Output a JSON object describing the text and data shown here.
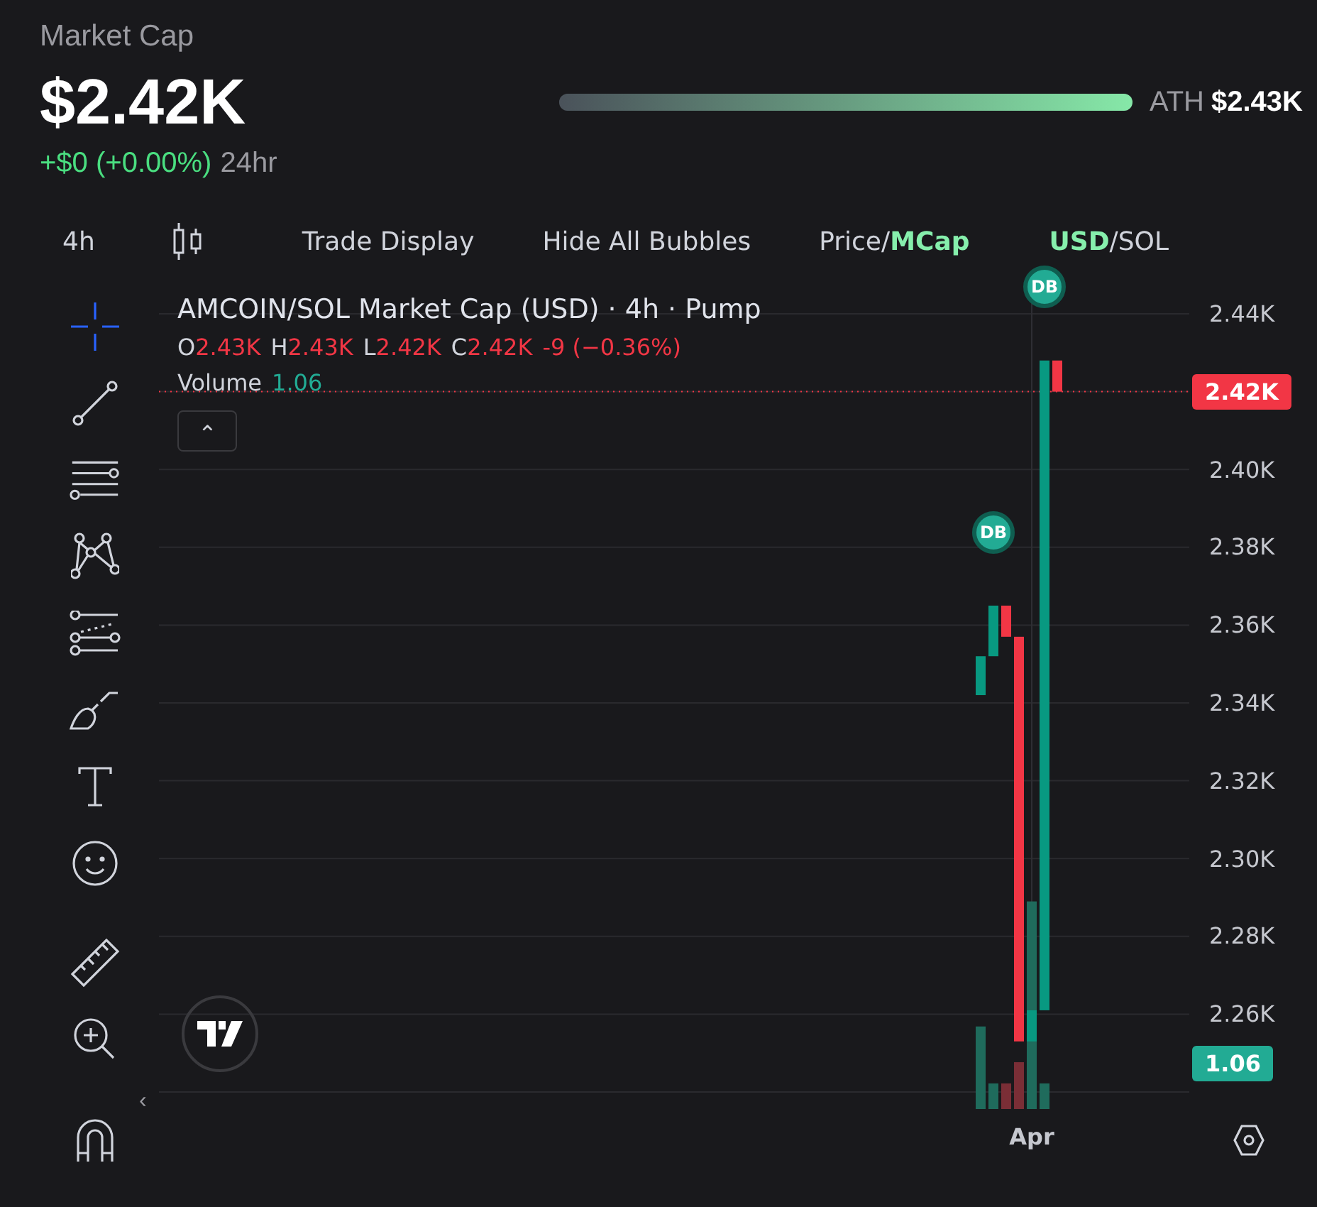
{
  "header": {
    "label": "Market Cap",
    "value": "$2.42K",
    "change": "+$0 (+0.00%)",
    "period": "24hr",
    "ath": {
      "level": 1,
      "label": "ATH",
      "value": "$2.43K"
    }
  },
  "toolbar": {
    "interval": "4h",
    "items": [
      {
        "kind": "candles"
      },
      {
        "kind": "text",
        "label": "Trade Display"
      },
      {
        "kind": "text",
        "label": "Hide All Bubbles"
      },
      {
        "kind": "toggle",
        "separator": "/",
        "options": [
          {
            "label": "Price",
            "selected": false
          },
          {
            "label": "MCap",
            "selected": true
          }
        ]
      },
      {
        "kind": "toggle",
        "separator": "/",
        "options": [
          {
            "label": "USD",
            "selected": true
          },
          {
            "label": "SOL",
            "selected": false
          }
        ]
      }
    ]
  },
  "tools": [
    {
      "kind": "crosshair",
      "selected": true
    },
    {
      "kind": "trendline",
      "selected": false
    },
    {
      "kind": "hlines",
      "selected": false
    },
    {
      "kind": "pattern",
      "selected": false
    },
    {
      "kind": "fib",
      "selected": false
    },
    {
      "kind": "brush",
      "selected": false
    },
    {
      "kind": "text",
      "selected": false
    },
    {
      "kind": "emoji",
      "selected": false
    },
    {
      "kind": "ruler",
      "selected": false
    },
    {
      "kind": "zoom",
      "selected": false
    },
    {
      "kind": "magnet",
      "selected": false
    }
  ],
  "collapse_toggle": "‹",
  "legend": {
    "title": "AMCOIN/SOL Market Cap (USD) · 4h · Pump",
    "ohlc": [
      {
        "key": "O",
        "value": "2.43K"
      },
      {
        "key": "H",
        "value": "2.43K"
      },
      {
        "key": "L",
        "value": "2.42K"
      },
      {
        "key": "C",
        "value": "2.42K"
      }
    ],
    "change": "-9 (−0.36%)",
    "volume_label": "Volume",
    "volume_value": "1.06",
    "collapse_button": "⌃"
  },
  "chart": {
    "bubbles": [
      {
        "label": "DB"
      },
      {
        "label": "DB"
      }
    ],
    "y_axis": [
      {
        "kind": "tick",
        "label": "2.44K"
      },
      {
        "kind": "price",
        "label": "2.42K"
      },
      {
        "kind": "tick",
        "label": "2.40K"
      },
      {
        "kind": "tick",
        "label": "2.38K"
      },
      {
        "kind": "tick",
        "label": "2.36K"
      },
      {
        "kind": "tick",
        "label": "2.34K"
      },
      {
        "kind": "tick",
        "label": "2.32K"
      },
      {
        "kind": "tick",
        "label": "2.30K"
      },
      {
        "kind": "tick",
        "label": "2.28K"
      },
      {
        "kind": "tick",
        "label": "2.26K"
      },
      {
        "kind": "volume",
        "label": "1.06"
      }
    ],
    "x_axis": [
      {
        "label": "Apr"
      }
    ]
  }
}
